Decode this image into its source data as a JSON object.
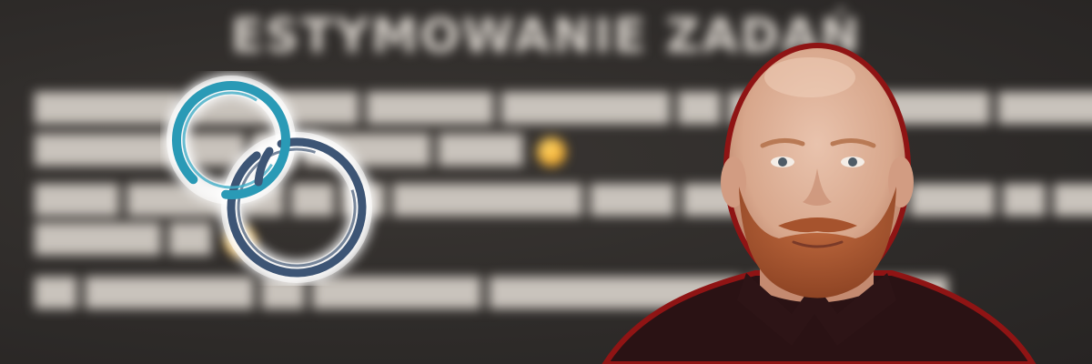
{
  "slide": {
    "title": "ESTYMOWANIE ZADAŃ"
  },
  "logo": {
    "name": "two-rings-logo",
    "colors": {
      "ring_a": "#2a9ab6",
      "ring_b": "#3d5575"
    }
  },
  "presenter": {
    "role": "speaker-webcam-cutout",
    "outline_color": "#8f1414"
  }
}
